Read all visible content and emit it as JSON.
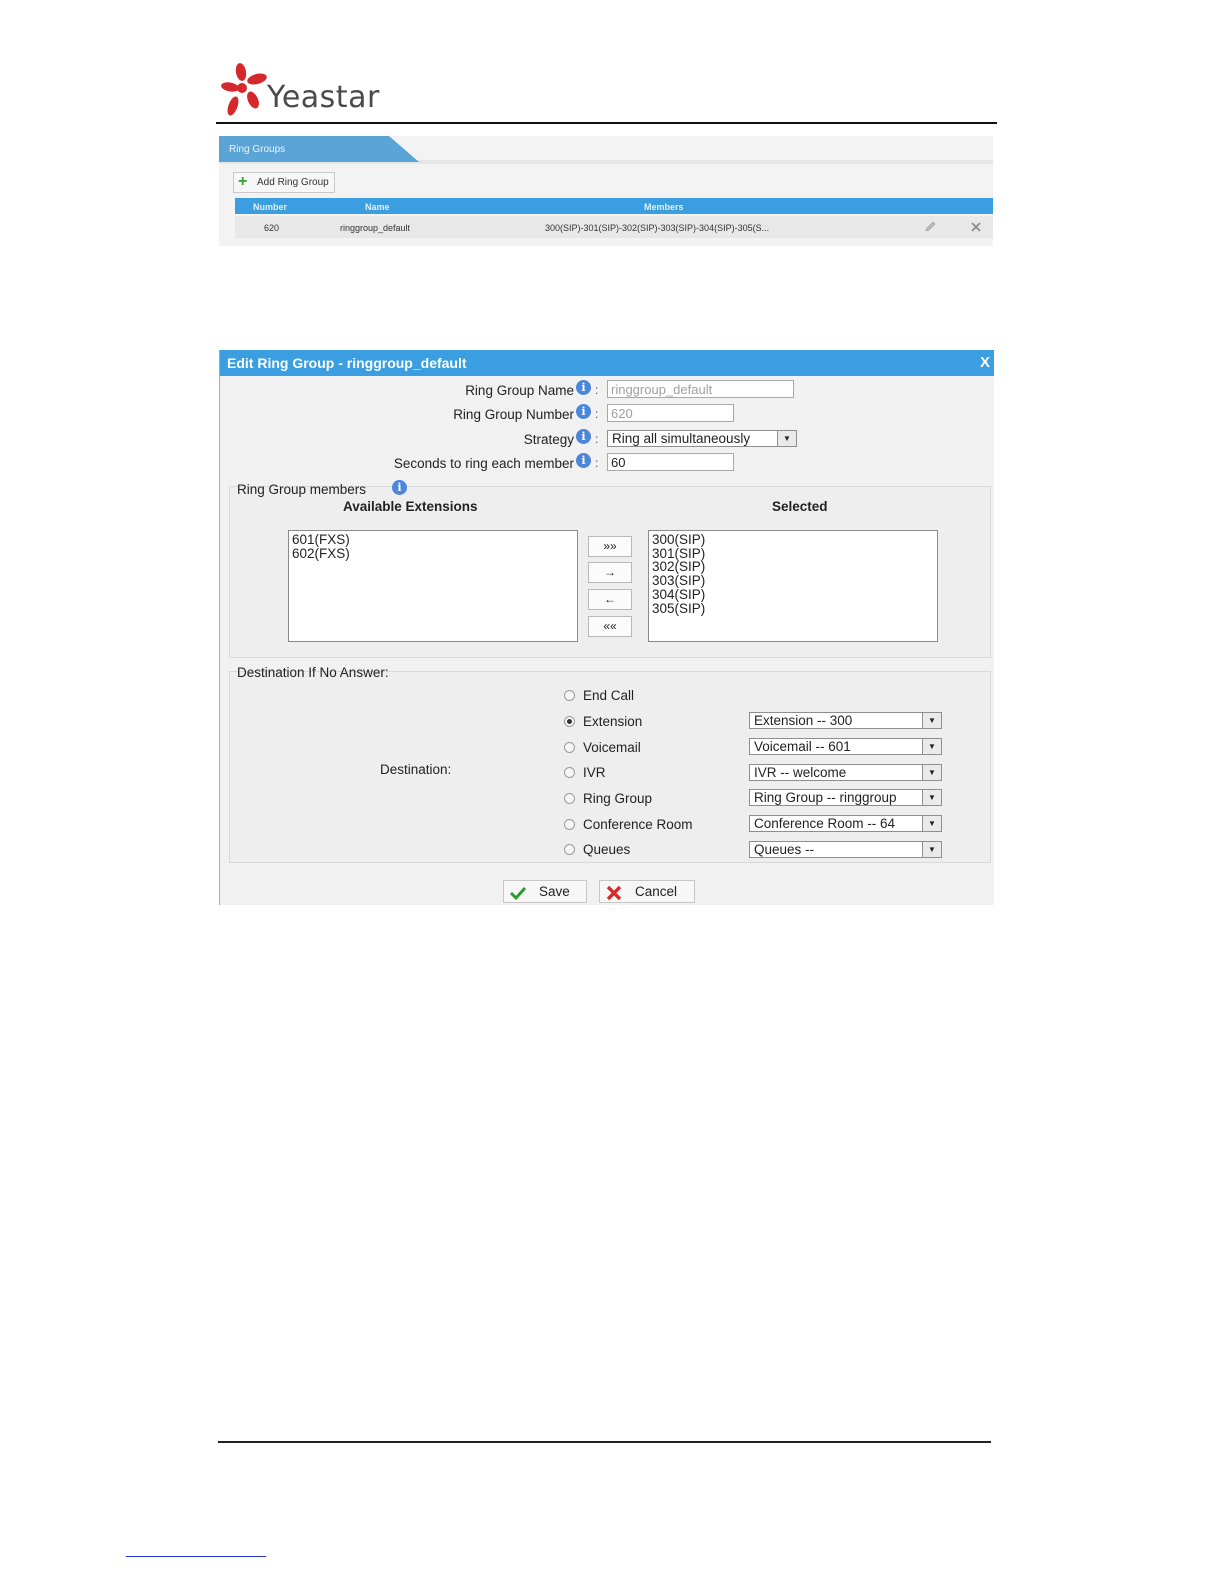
{
  "header": {
    "brand": "Yeastar",
    "colors": {
      "logo_red": "#d4282d",
      "rule": "#111111"
    },
    "logo_icon": "flower-logo-icon"
  },
  "ring_groups_list": {
    "tab_label": "Ring Groups",
    "add_button_label": "Add Ring Group",
    "columns": [
      "Number",
      "Name",
      "Members"
    ],
    "rows": [
      {
        "number": "620",
        "name": "ringgroup_default",
        "members": "300(SIP)-301(SIP)-302(SIP)-303(SIP)-304(SIP)-305(S..."
      }
    ],
    "row_icons": [
      "edit-icon",
      "delete-icon"
    ],
    "accent": "#3a9ee0"
  },
  "dialog": {
    "title": "Edit Ring Group - ringgroup_default",
    "close_glyph": "X",
    "fields": {
      "name_label": "Ring Group Name",
      "name_value": "ringgroup_default",
      "number_label": "Ring Group Number",
      "number_value": "620",
      "strategy_label": "Strategy",
      "strategy_value": "Ring all simultaneously",
      "seconds_label": "Seconds to ring each member",
      "seconds_value": "60"
    },
    "members": {
      "section_label": "Ring Group members",
      "available_heading": "Available Extensions",
      "selected_heading": "Selected",
      "available": [
        "601(FXS)",
        "602(FXS)"
      ],
      "selected": [
        "300(SIP)",
        "301(SIP)",
        "302(SIP)",
        "303(SIP)",
        "304(SIP)",
        "305(SIP)"
      ],
      "buttons": [
        "»»",
        "→",
        "←",
        "««"
      ]
    },
    "destination": {
      "section_label": "Destination If No Answer:",
      "label": "Destination:",
      "options": [
        {
          "label": "End Call",
          "selected": false,
          "select_value": ""
        },
        {
          "label": "Extension",
          "selected": true,
          "select_value": "Extension -- 300"
        },
        {
          "label": "Voicemail",
          "selected": false,
          "select_value": "Voicemail -- 601"
        },
        {
          "label": "IVR",
          "selected": false,
          "select_value": "IVR -- welcome"
        },
        {
          "label": "Ring Group",
          "selected": false,
          "select_value": "Ring Group -- ringgroup"
        },
        {
          "label": "Conference Room",
          "selected": false,
          "select_value": "Conference Room -- 64"
        },
        {
          "label": "Queues",
          "selected": false,
          "select_value": "Queues --"
        }
      ]
    },
    "save_label": "Save",
    "cancel_label": "Cancel",
    "save_icon": "checkmark-icon",
    "cancel_icon": "red-x-icon"
  }
}
